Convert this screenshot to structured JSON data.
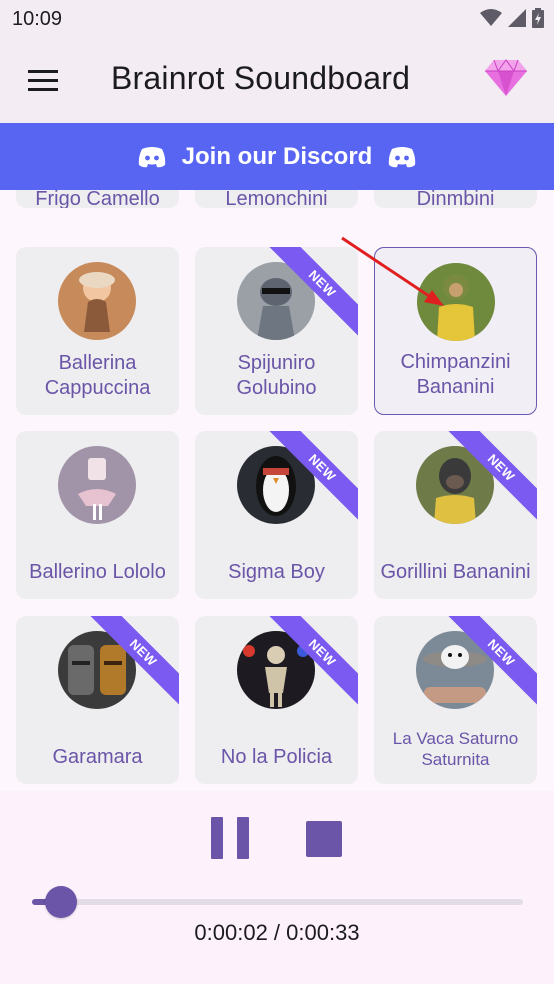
{
  "status_bar": {
    "time": "10:09",
    "icons": [
      "wifi-icon",
      "signal-icon",
      "battery-icon"
    ]
  },
  "app_bar": {
    "title": "Brainrot Soundboard",
    "menu_icon": "hamburger-menu-icon",
    "premium_icon": "diamond-icon"
  },
  "discord_banner": {
    "label": "Join our Discord",
    "icon": "discord-icon",
    "background": "#5865F2"
  },
  "partial_row": {
    "labels": [
      "Frigo Camello",
      "Lemonchini",
      "Dinmbini"
    ]
  },
  "sounds": [
    {
      "id": "ballerina-cappuccina",
      "label": "Ballerina Cappuccina",
      "badge": ""
    },
    {
      "id": "spijuniro-golubino",
      "label": "Spijuniro Golubino",
      "badge": "NEW"
    },
    {
      "id": "chimpanzini-bananini",
      "label": "Chimpanzini Bananini",
      "badge": "",
      "selected": true
    },
    {
      "id": "ballerino-lololo",
      "label": "Ballerino Lololo",
      "badge": ""
    },
    {
      "id": "sigma-boy",
      "label": "Sigma Boy",
      "badge": "NEW"
    },
    {
      "id": "gorillini-bananini",
      "label": "Gorillini Bananini",
      "badge": "NEW"
    },
    {
      "id": "garamara",
      "label": "Garamara",
      "badge": "NEW"
    },
    {
      "id": "no-la-policia",
      "label": "No la Policia",
      "badge": "NEW"
    },
    {
      "id": "la-vaca-saturno-saturnita",
      "label": "La Vaca Saturno Saturnita",
      "badge": "NEW"
    }
  ],
  "player": {
    "elapsed": "0:00:02",
    "total": "0:00:33",
    "time_display": "0:00:02 / 0:00:33",
    "progress": 0.06,
    "pause_icon": "pause-icon",
    "stop_icon": "stop-icon",
    "accent": "#6A55A8"
  }
}
